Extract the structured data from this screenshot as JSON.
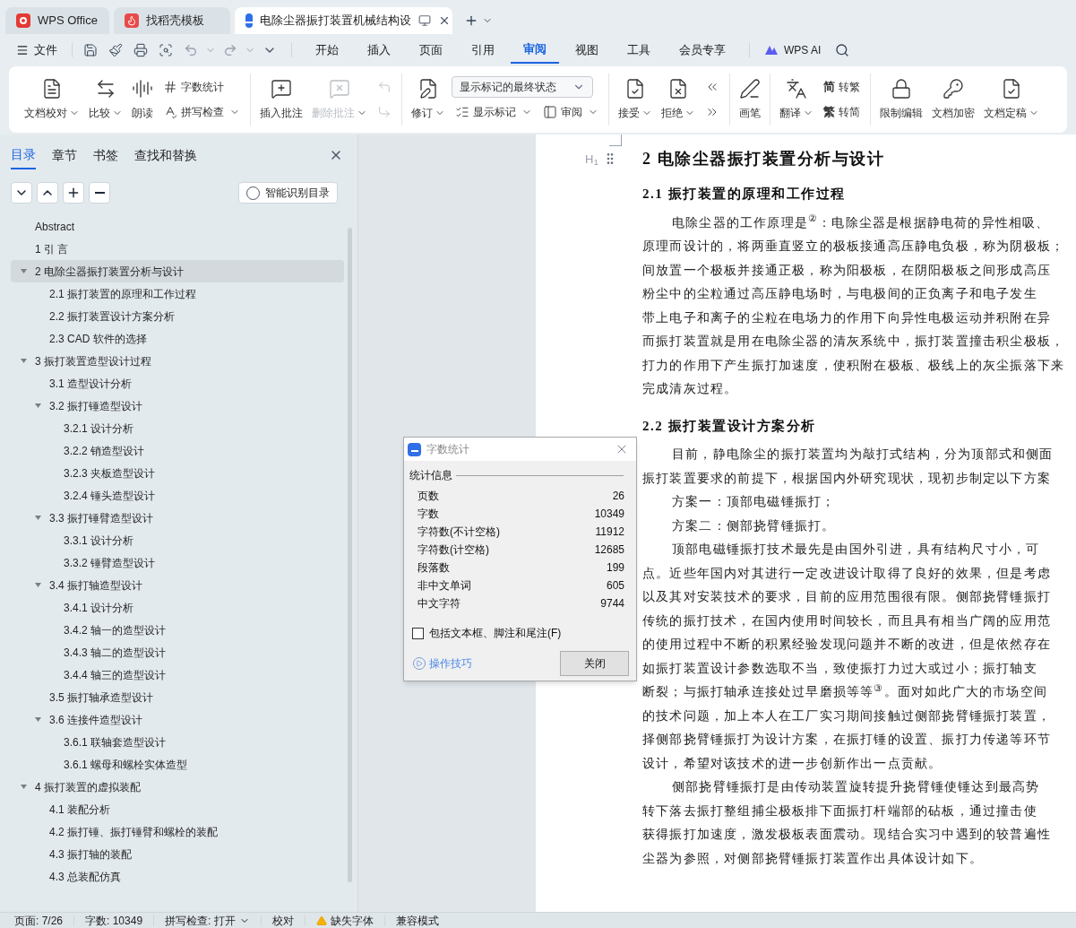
{
  "title_tabs": [
    {
      "label": "WPS Office",
      "selected": false,
      "kind": "home"
    },
    {
      "label": "找稻壳模板",
      "selected": false,
      "kind": "template"
    },
    {
      "label": "电除尘器振打装置机械结构设",
      "selected": true,
      "kind": "doc"
    }
  ],
  "menu": {
    "file": "文件",
    "tabs": [
      {
        "label": "开始",
        "selected": false
      },
      {
        "label": "插入",
        "selected": false
      },
      {
        "label": "页面",
        "selected": false
      },
      {
        "label": "引用",
        "selected": false
      },
      {
        "label": "审阅",
        "selected": true
      },
      {
        "label": "视图",
        "selected": false
      },
      {
        "label": "工具",
        "selected": false
      },
      {
        "label": "会员专享",
        "selected": false
      }
    ],
    "ai": "WPS AI"
  },
  "ribbon": [
    {
      "items": [
        {
          "kind": "big",
          "label": "文档校对",
          "caret": true,
          "disabled": false
        },
        {
          "kind": "big",
          "label": "比较",
          "caret": true,
          "disabled": false
        },
        {
          "kind": "big",
          "label": "朗读",
          "caret": false,
          "disabled": false
        },
        {
          "kind": "stack",
          "rows": [
            {
              "label": "字数统计",
              "caret": false,
              "disabled": false
            },
            {
              "label": "拼写检查",
              "caret": true,
              "disabled": false
            }
          ]
        }
      ]
    },
    {
      "items": [
        {
          "kind": "big",
          "label": "插入批注",
          "caret": false,
          "disabled": false
        },
        {
          "kind": "big",
          "label": "删除批注",
          "caret": true,
          "disabled": true
        },
        {
          "kind": "stack",
          "rows": [
            {
              "disabled": true
            },
            {
              "disabled": true
            }
          ]
        }
      ]
    },
    {
      "items": [
        {
          "kind": "big",
          "label": "修订",
          "caret": true,
          "disabled": false
        },
        {
          "kind": "combo",
          "value": "显示标记的最终状态",
          "rows": [
            {
              "label": "显示标记",
              "caret": true,
              "disabled": false
            },
            {
              "label": "审阅",
              "caret": true,
              "disabled": false
            }
          ]
        }
      ]
    },
    {
      "items": [
        {
          "kind": "big",
          "label": "接受",
          "caret": true,
          "disabled": false
        },
        {
          "kind": "big",
          "label": "拒绝",
          "caret": true,
          "disabled": false
        },
        {
          "kind": "stack",
          "rows": [
            {
              "disabled": false
            },
            {
              "disabled": false
            }
          ]
        }
      ]
    },
    {
      "items": [
        {
          "kind": "big",
          "label": "画笔",
          "caret": false,
          "disabled": false
        }
      ]
    },
    {
      "items": [
        {
          "kind": "big",
          "label": "翻译",
          "caret": true,
          "disabled": false
        },
        {
          "kind": "stack",
          "rows": [
            {
              "glyph": "简",
              "label": "转繁",
              "caret": false,
              "disabled": false
            },
            {
              "glyph": "繁",
              "label": "转简",
              "caret": false,
              "disabled": false
            }
          ]
        }
      ]
    },
    {
      "items": [
        {
          "kind": "big",
          "label": "限制编辑",
          "caret": false,
          "disabled": false
        },
        {
          "kind": "big",
          "label": "文档加密",
          "caret": false,
          "disabled": false
        },
        {
          "kind": "big",
          "label": "文档定稿",
          "caret": true,
          "disabled": false
        }
      ]
    }
  ],
  "sidebar": {
    "tabs": [
      {
        "label": "目录",
        "selected": true
      },
      {
        "label": "章节",
        "selected": false
      },
      {
        "label": "书签",
        "selected": false
      },
      {
        "label": "查找和替换",
        "selected": false
      }
    ],
    "smart_button": "智能识别目录",
    "toc": [
      {
        "label": "Abstract",
        "selected": false
      },
      {
        "label": "1 引 言",
        "selected": false
      },
      {
        "label": "2  电除尘器振打装置分析与设计",
        "selected": true,
        "expanded": true,
        "children": [
          {
            "label": "2.1  振打装置的原理和工作过程",
            "selected": false
          },
          {
            "label": "2.2  振打装置设计方案分析",
            "selected": false
          },
          {
            "label": "2.3 CAD 软件的选择",
            "selected": false
          }
        ]
      },
      {
        "label": "3  振打装置造型设计过程",
        "selected": false,
        "expanded": true,
        "children": [
          {
            "label": "3.1  造型设计分析",
            "selected": false
          },
          {
            "label": "3.2  振打锤造型设计",
            "selected": false,
            "expanded": true,
            "children": [
              {
                "label": "3.2.1  设计分析",
                "selected": false
              },
              {
                "label": "3.2.2  销造型设计",
                "selected": false
              },
              {
                "label": "3.2.3  夹板造型设计",
                "selected": false
              },
              {
                "label": "3.2.4  锤头造型设计",
                "selected": false
              }
            ]
          },
          {
            "label": "3.3  振打锤臂造型设计",
            "selected": false,
            "expanded": true,
            "children": [
              {
                "label": "3.3.1  设计分析",
                "selected": false
              },
              {
                "label": "3.3.2  锤臂造型设计",
                "selected": false
              }
            ]
          },
          {
            "label": "3.4  振打轴造型设计",
            "selected": false,
            "expanded": true,
            "children": [
              {
                "label": "3.4.1  设计分析",
                "selected": false
              },
              {
                "label": "3.4.2  轴一的造型设计",
                "selected": false
              },
              {
                "label": "3.4.3  轴二的造型设计",
                "selected": false
              },
              {
                "label": "3.4.4  轴三的造型设计",
                "selected": false
              }
            ]
          },
          {
            "label": "3.5  振打轴承造型设计",
            "selected": false
          },
          {
            "label": "3.6  连接件造型设计",
            "selected": false,
            "expanded": true,
            "children": [
              {
                "label": "3.6.1 联轴套造型设计",
                "selected": false
              },
              {
                "label": "3.6.1 螺母和螺栓实体造型",
                "selected": false
              }
            ]
          }
        ]
      },
      {
        "label": "4  振打装置的虚拟装配",
        "selected": false,
        "expanded": true,
        "children": [
          {
            "label": "4.1  装配分析",
            "selected": false
          },
          {
            "label": "4.2  振打锤、振打锤臂和螺栓的装配",
            "selected": false
          },
          {
            "label": "4.3  振打轴的装配",
            "selected": false
          },
          {
            "label": "4.3  总装配仿真",
            "selected": false
          }
        ]
      }
    ]
  },
  "document": {
    "heading_marker": "H$_{1}$",
    "blocks": [
      {
        "kind": "h1",
        "text": "2  电除尘器振打装置分析与设计"
      },
      {
        "kind": "h2",
        "text": "2.1  振打装置的原理和工作过程"
      },
      {
        "kind": "para",
        "lines": [
          "电除尘器的工作原理是$^{②}$：电除尘器是根据静电荷的异性相吸、",
          "原理而设计的，将两垂直竖立的极板接通高压静电负极，称为阴极板；",
          "间放置一个极板并接通正极，称为阳极板，在阴阳极板之间形成高压",
          "粉尘中的尘粒通过高压静电场时，与电极间的正负离子和电子发生",
          "带上电子和离子的尘粒在电场力的作用下向异性电极运动并积附在异",
          "而振打装置就是用在电除尘器的清灰系统中，振打装置撞击积尘极板，",
          "打力的作用下产生振打加速度，使积附在极板、极线上的灰尘振落下来",
          "完成清灰过程。"
        ]
      },
      {
        "kind": "h2",
        "text": "2.2  振打装置设计方案分析"
      },
      {
        "kind": "para",
        "lines": [
          "目前，静电除尘的振打装置均为敲打式结构，分为顶部式和侧面",
          "振打装置要求的前提下，根据国内外研究现状，现初步制定以下方案"
        ]
      },
      {
        "kind": "para",
        "lines": [
          "方案一：顶部电磁锤振打；"
        ]
      },
      {
        "kind": "para",
        "lines": [
          "方案二：侧部挠臂锤振打。"
        ]
      },
      {
        "kind": "para",
        "lines": [
          "顶部电磁锤振打技术最先是由国外引进，具有结构尺寸小，可",
          "点。近些年国内对其进行一定改进设计取得了良好的效果，但是考虑",
          "以及其对安装技术的要求，目前的应用范围很有限。侧部挠臂锤振打",
          "传统的振打技术，在国内使用时间较长，而且具有相当广阔的应用范",
          "的使用过程中不断的积累经验发现问题并不断的改进，但是依然存在",
          "如振打装置设计参数选取不当，致使振打力过大或过小；振打轴支",
          "断裂；与振打轴承连接处过早磨损等等$^{③}$。面对如此广大的市场空间",
          "的技术问题，加上本人在工厂实习期间接触过侧部挠臂锤振打装置，",
          "择侧部挠臂锤振打为设计方案，在振打锤的设置、振打力传递等环节",
          "设计，希望对该技术的进一步创新作出一点贡献。"
        ]
      },
      {
        "kind": "para",
        "lines": [
          "侧部挠臂锤振打是由传动装置旋转提升挠臂锤使锤达到最高势",
          "转下落去振打整组捕尘极板排下面振打杆端部的砧板，通过撞击使",
          "获得振打加速度，激发极板表面震动。现结合实习中遇到的较普遍性",
          "尘器为参照，对侧部挠臂锤振打装置作出具体设计如下。"
        ]
      }
    ]
  },
  "dialog": {
    "title": "字数统计",
    "section": "统计信息",
    "rows": [
      {
        "label": "页数",
        "value": "26"
      },
      {
        "label": "字数",
        "value": "10349"
      },
      {
        "label": "字符数(不计空格)",
        "value": "11912"
      },
      {
        "label": "字符数(计空格)",
        "value": "12685"
      },
      {
        "label": "段落数",
        "value": "199"
      },
      {
        "label": "非中文单词",
        "value": "605"
      },
      {
        "label": "中文字符",
        "value": "9744"
      }
    ],
    "checkbox": {
      "label": "包括文本框、脚注和尾注(F)",
      "checked": false
    },
    "tips": "操作技巧",
    "close": "关闭"
  },
  "status_bar": [
    {
      "kind": "text",
      "label": "页面: 7/26"
    },
    {
      "kind": "text",
      "label": "字数: 10349"
    },
    {
      "kind": "menu",
      "label": "拼写检查: 打开"
    },
    {
      "kind": "text",
      "label": "校对"
    },
    {
      "kind": "warning",
      "label": "缺失字体"
    },
    {
      "kind": "text",
      "label": "兼容模式"
    }
  ]
}
